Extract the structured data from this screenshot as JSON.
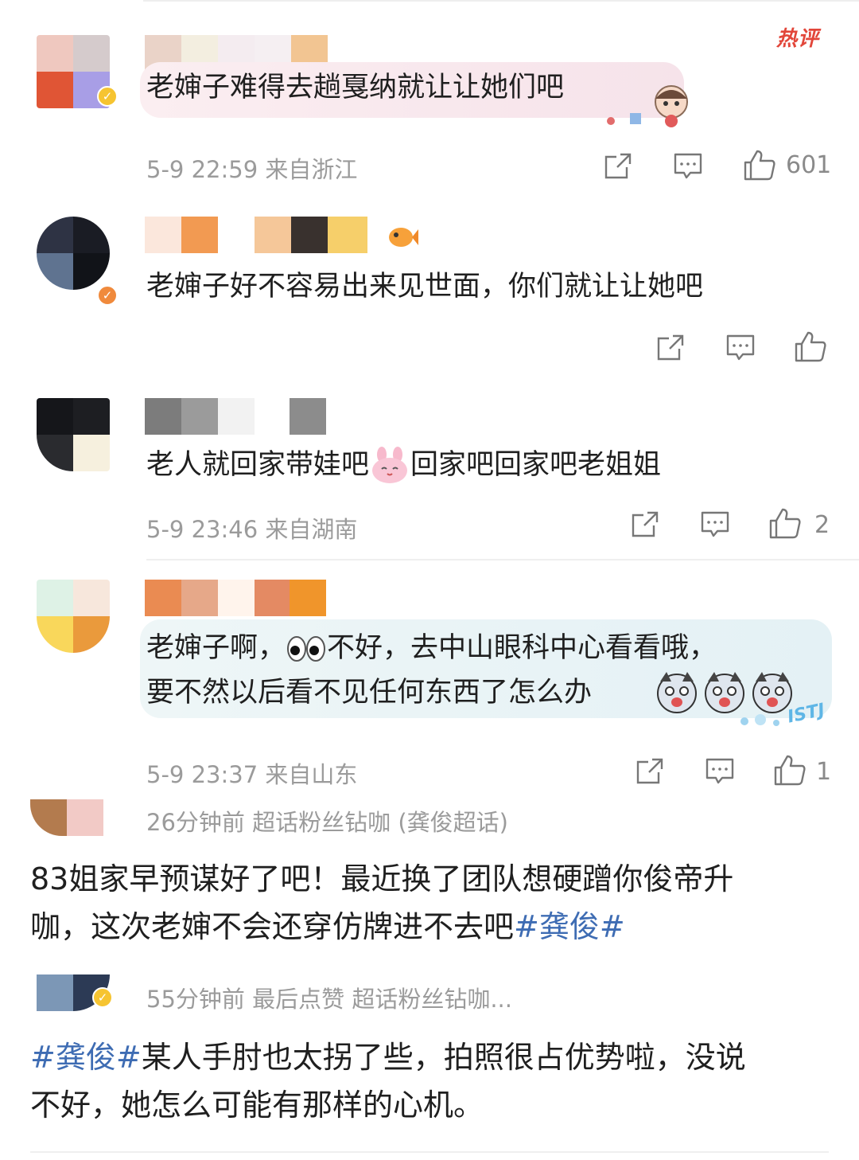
{
  "comments": [
    {
      "text": "老婶子难得去趟戛纳就让让她们吧",
      "meta": "5-9 22:59 来自浙江",
      "likes": "601",
      "hot_label": "热评"
    },
    {
      "text": "老婶子好不容易出来见世面，你们就让让她吧",
      "meta": "",
      "likes": ""
    },
    {
      "text_before_emoji": "老人就回家带娃吧",
      "text_after_emoji": "回家吧回家吧老姐姐",
      "meta": "5-9 23:46 来自湖南",
      "likes": "2"
    },
    {
      "line1_before_emoji": "老婶子啊，",
      "line1_after_emoji": "不好，去中山眼科中心看看哦，",
      "line2": "要不然以后看不见任何东西了怎么办",
      "meta": "5-9 23:37 来自山东",
      "likes": "1",
      "bubble_tag": "ISTJ"
    }
  ],
  "posts": [
    {
      "meta": "26分钟前  超话粉丝钻咖 (龚俊超话)",
      "line1": "83姐家早预谋好了吧！最近换了团队想硬蹭你俊帝升",
      "line2_before_tag": "咖，这次老婶不会还穿仿牌进不去吧",
      "hashtag": "#龚俊#"
    },
    {
      "meta": "55分钟前  最后点赞  超话粉丝钻咖...",
      "hashtag": "#龚俊#",
      "line1_after_tag": "某人手肘也太拐了些，拍照很占优势啦，没说",
      "line2": "不好，她怎么可能有那样的心机。"
    }
  ],
  "icons": [
    "share-icon",
    "comment-icon",
    "like-icon"
  ],
  "colors": {
    "hashtag": "#3e6cb3",
    "hot_label": "#e2463a",
    "meta_text": "#9b9b9b",
    "verified_badge": "#f6c431"
  }
}
